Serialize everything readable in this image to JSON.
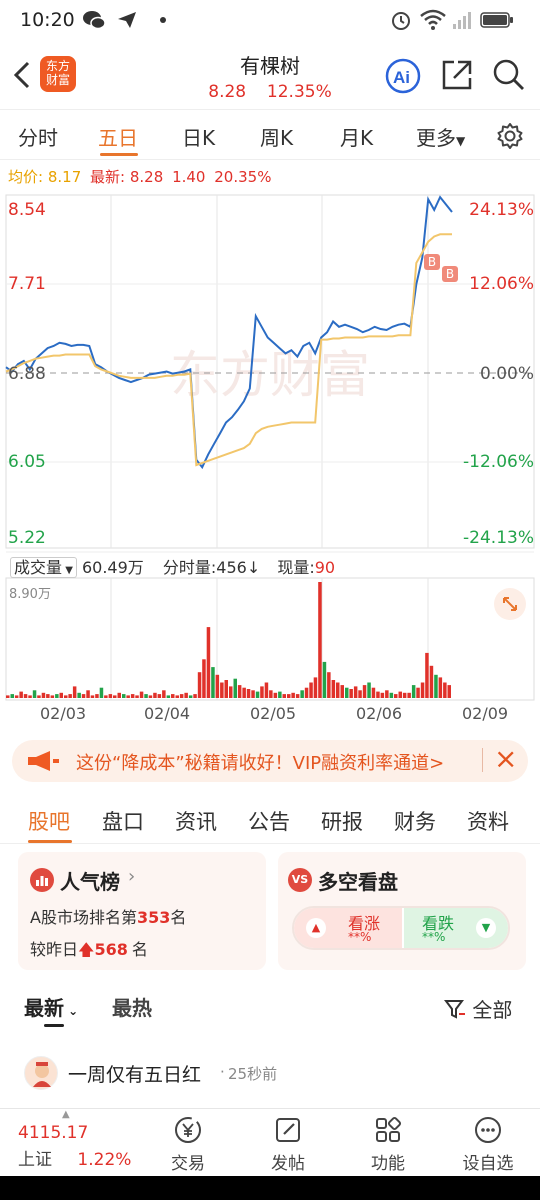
{
  "status": {
    "time": "10:20"
  },
  "header": {
    "app_logo": "东方财富",
    "title": "有棵树",
    "price": "8.28",
    "change_pct": "12.35%"
  },
  "period_tabs": [
    "分时",
    "五日",
    "日K",
    "周K",
    "月K",
    "更多"
  ],
  "active_period": "五日",
  "avg_line": {
    "avg_label": "均价:",
    "avg_value": "8.17",
    "latest_label": "最新:",
    "latest_value": "8.28",
    "change": "1.40",
    "change_pct": "20.35%"
  },
  "chart_data": {
    "type": "line",
    "y_left_ticks": [
      "8.54",
      "7.71",
      "6.88",
      "6.05",
      "5.22"
    ],
    "y_right_ticks": [
      "24.13%",
      "12.06%",
      "0.00%",
      "-12.06%",
      "-24.13%"
    ],
    "ylim": [
      5.22,
      8.54
    ],
    "x_labels": [
      "02/03",
      "02/04",
      "02/05",
      "02/06",
      "02/09"
    ],
    "watermark": "东方财富",
    "series": [
      {
        "color": "#2b6cc4",
        "values": [
          6.92,
          6.88,
          6.95,
          6.98,
          6.9,
          7.0,
          7.05,
          7.1,
          7.12,
          7.15,
          7.14,
          7.12,
          7.13,
          7.13,
          7.12,
          6.95,
          6.92,
          6.88,
          6.85,
          6.82,
          6.8,
          6.78,
          6.8,
          6.82,
          6.85,
          6.86,
          6.87,
          6.88,
          6.86,
          6.87,
          6.88,
          6.9,
          6.05,
          5.98,
          6.1,
          6.2,
          6.3,
          6.4,
          6.45,
          6.52,
          6.6,
          6.72,
          7.4,
          7.3,
          7.2,
          7.15,
          7.1,
          7.05,
          7.08,
          7.02,
          7.12,
          7.15,
          7.05,
          7.2,
          7.25,
          7.35,
          7.3,
          7.32,
          7.3,
          7.28,
          7.25,
          7.27,
          7.3,
          7.28,
          7.27,
          7.3,
          7.32,
          7.33,
          7.3,
          7.7,
          7.95,
          8.5,
          8.4,
          8.52,
          8.45,
          8.38
        ]
      },
      {
        "color": "#f2c66b",
        "values": [
          6.88,
          6.9,
          6.93,
          6.96,
          6.98,
          7.0,
          7.01,
          7.02,
          7.03,
          7.03,
          7.04,
          7.04,
          7.04,
          7.04,
          7.04,
          6.93,
          6.9,
          6.88,
          6.86,
          6.84,
          6.83,
          6.82,
          6.82,
          6.82,
          6.82,
          6.82,
          6.83,
          6.84,
          6.84,
          6.85,
          6.85,
          6.86,
          6.0,
          6.02,
          6.04,
          6.06,
          6.08,
          6.1,
          6.12,
          6.14,
          6.16,
          6.2,
          6.3,
          6.34,
          6.36,
          6.37,
          6.38,
          6.39,
          6.4,
          6.4,
          6.4,
          6.4,
          6.4,
          7.18,
          7.18,
          7.19,
          7.19,
          7.2,
          7.2,
          7.2,
          7.2,
          7.21,
          7.21,
          7.21,
          7.21,
          7.21,
          7.22,
          7.22,
          7.22,
          7.9,
          8.0,
          8.1,
          8.15,
          8.17,
          8.17,
          8.17
        ]
      }
    ],
    "markers": [
      "B",
      "B"
    ],
    "volume": {
      "label": "成交量",
      "value": "60.49万",
      "fenshi_label": "分时量:456",
      "fenshi_arrow": "↓",
      "now_label": "现量:",
      "now_value": "90",
      "max_label": "8.90万",
      "bars": [
        2,
        3,
        2,
        5,
        3,
        2,
        6,
        2,
        4,
        3,
        2,
        3,
        4,
        2,
        3,
        9,
        4,
        3,
        6,
        2,
        3,
        8,
        2,
        3,
        2,
        4,
        3,
        2,
        3,
        2,
        5,
        3,
        2,
        4,
        3,
        6,
        2,
        3,
        2,
        3,
        4,
        2,
        3,
        20,
        30,
        55,
        24,
        18,
        12,
        14,
        9,
        15,
        10,
        8,
        7,
        6,
        5,
        9,
        12,
        6,
        4,
        5,
        3,
        3,
        4,
        3,
        6,
        8,
        12,
        16,
        90,
        28,
        20,
        14,
        12,
        10,
        8,
        7,
        9,
        6,
        10,
        12,
        8,
        5,
        4,
        6,
        4,
        3,
        5,
        4,
        4,
        10,
        8,
        12,
        35,
        25,
        18,
        16,
        12,
        10
      ],
      "colors": [
        "#e0312a",
        "#22a34a"
      ]
    }
  },
  "banner": {
    "text": "这份“降成本”秘籍请收好！VIP融资利率通道>",
    "close_label": "×"
  },
  "section_tabs": [
    "股吧",
    "盘口",
    "资讯",
    "公告",
    "研报",
    "财务",
    "资料"
  ],
  "active_section": "股吧",
  "popularity_card": {
    "title": "人气榜",
    "rank_prefix": "A股市场排名第",
    "rank": "353",
    "rank_suffix": "名",
    "vs_prefix": "较昨日",
    "vs_value": "568",
    "vs_suffix": "名"
  },
  "longshort_card": {
    "title": "多空看盘",
    "bull_label": "看涨",
    "bull_pct": "**%",
    "bear_label": "看跌",
    "bear_pct": "**%"
  },
  "feed": {
    "tab_latest": "最新",
    "tab_hot": "最热",
    "filter_label": "全部",
    "post_title": "一周仅有五日红",
    "post_time": "25秒前"
  },
  "bottom_bar": {
    "index_value": "4115.17",
    "index_name": "上证",
    "index_change": "1.22%",
    "items": [
      "交易",
      "发帖",
      "功能",
      "设自选"
    ]
  }
}
